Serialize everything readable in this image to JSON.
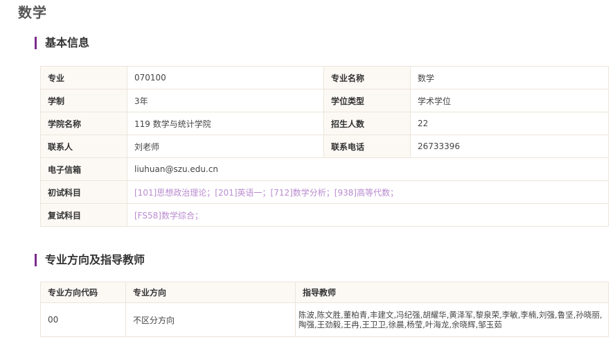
{
  "page_title": "数学",
  "basic": {
    "heading": "基本信息",
    "major_code_label": "专业",
    "major_code": "070100",
    "major_name_label": "专业名称",
    "major_name": "数学",
    "duration_label": "学制",
    "duration": "3年",
    "degree_type_label": "学位类型",
    "degree_type": "学术学位",
    "college_label": "学院名称",
    "college": "119 数学与统计学院",
    "enrollment_label": "招生人数",
    "enrollment": "22",
    "contact_label": "联系人",
    "contact": "刘老师",
    "phone_label": "联系电话",
    "phone": "26733396",
    "email_label": "电子信箱",
    "email": "liuhuan@szu.edu.cn",
    "prelim_label": "初试科目",
    "prelim": "[101]思想政治理论；[201]英语一；[712]数学分析；[938]高等代数；",
    "retest_label": "复试科目",
    "retest": "[FS58]数学综合；"
  },
  "directions": {
    "heading": "专业方向及指导教师",
    "columns": [
      "专业方向代码",
      "专业方向",
      "指导教师"
    ],
    "rows": [
      {
        "code": "00",
        "direction": "不区分方向",
        "teachers": "陈波,陈文胜,董柏青,丰建文,冯纪强,胡耀华,黄泽军,黎泉荣,李敏,李楠,刘强,鲁坚,孙晓丽,陶强,王劲毅,王冉,王卫卫,徐晨,杨莹,叶海龙,余晓辉,邹玉茹"
      }
    ]
  },
  "colors": {
    "accent": "#7b2b8c",
    "subject_link": "#b98ad0",
    "label_bg": "#fcf9f5",
    "border": "#ece4da"
  }
}
